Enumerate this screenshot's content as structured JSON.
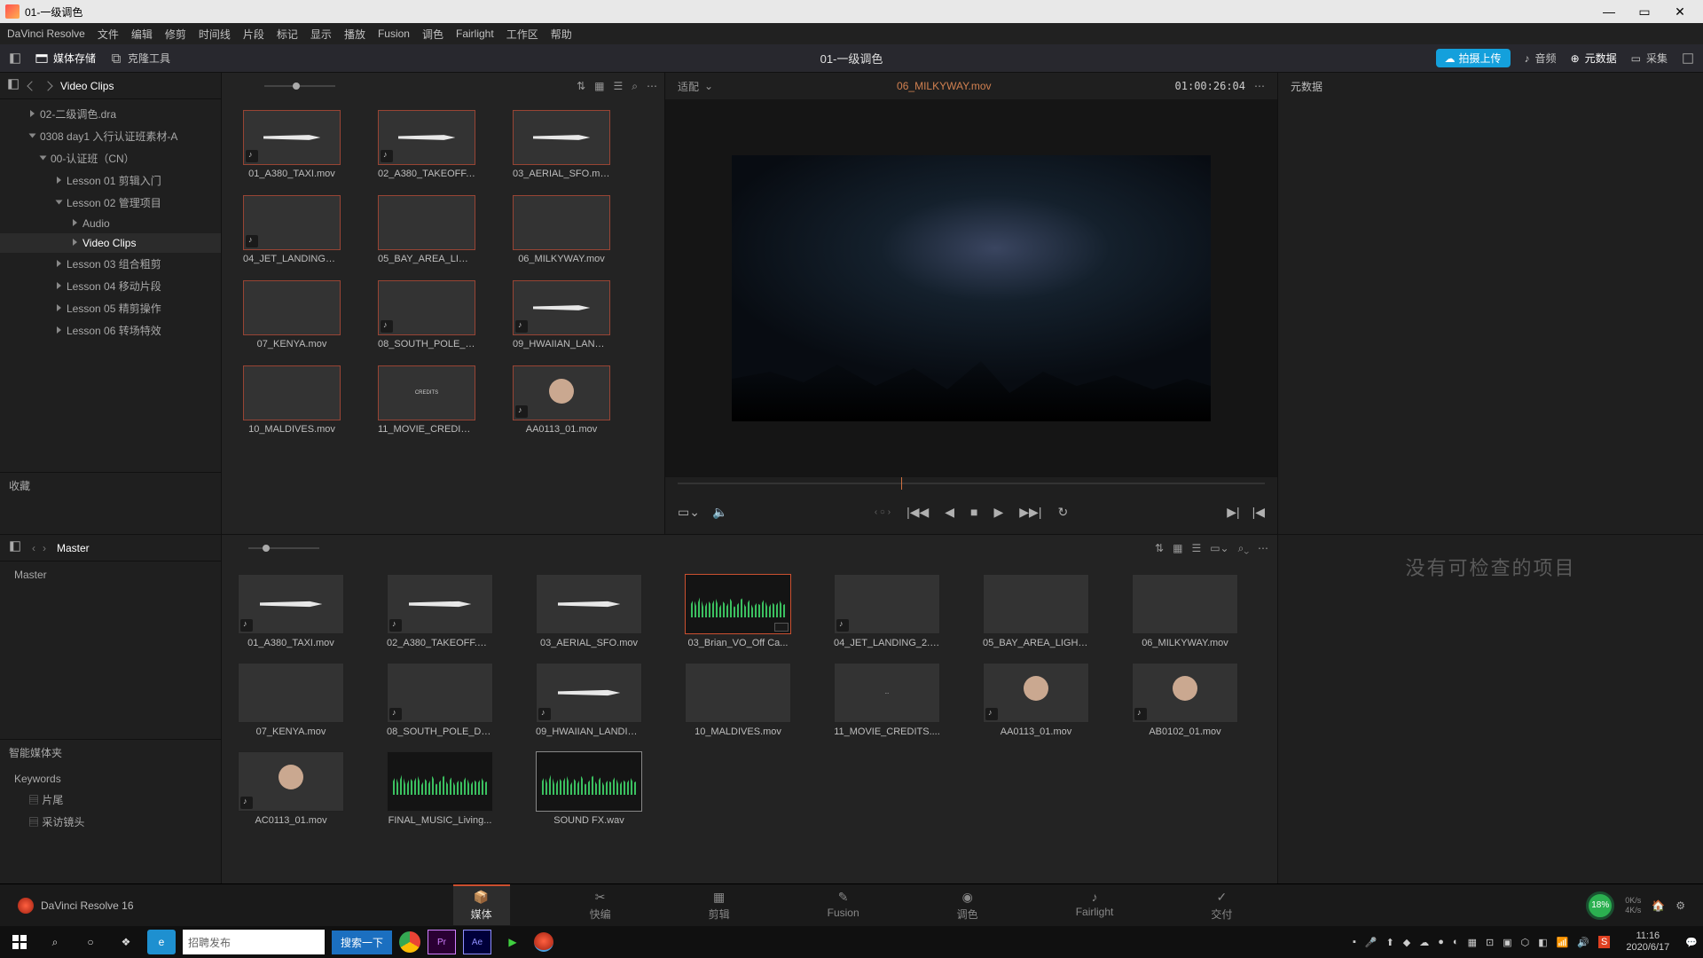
{
  "window": {
    "title": "01-一级调色"
  },
  "menu": [
    "DaVinci Resolve",
    "文件",
    "编辑",
    "修剪",
    "时间线",
    "片段",
    "标记",
    "显示",
    "播放",
    "Fusion",
    "调色",
    "Fairlight",
    "工作区",
    "帮助"
  ],
  "toolbar": {
    "media_pool": "媒体存储",
    "clone_tool": "克隆工具",
    "center_title": "01-一级调色",
    "upload_btn": "拍摄上传",
    "audio": "音频",
    "metadata": "元数据",
    "capture": "采集"
  },
  "tree": {
    "header_label": "Video Clips",
    "items": [
      {
        "lvl": 0,
        "open": false,
        "label": "02-二级调色.dra"
      },
      {
        "lvl": 0,
        "open": true,
        "label": "0308 day1 入行认证班素材-A"
      },
      {
        "lvl": 1,
        "open": true,
        "label": "00-认证班（CN）"
      },
      {
        "lvl": 2,
        "open": false,
        "label": "Lesson 01 剪辑入门"
      },
      {
        "lvl": 2,
        "open": true,
        "label": "Lesson 02 管理项目"
      },
      {
        "lvl": 3,
        "open": false,
        "label": "Audio"
      },
      {
        "lvl": 3,
        "open": false,
        "label": "Video Clips",
        "sel": true
      },
      {
        "lvl": 2,
        "open": false,
        "label": "Lesson 03 组合粗剪"
      },
      {
        "lvl": 2,
        "open": false,
        "label": "Lesson 04 移动片段"
      },
      {
        "lvl": 2,
        "open": false,
        "label": "Lesson 05 精剪操作"
      },
      {
        "lvl": 2,
        "open": false,
        "label": "Lesson 06 转场特效"
      }
    ],
    "favorites": "收藏"
  },
  "source_clips": [
    {
      "name": "01_A380_TAXI.mov",
      "bg": "bg-plane",
      "aud": true,
      "ob": true
    },
    {
      "name": "02_A380_TAKEOFF.m...",
      "bg": "bg-plane",
      "aud": true,
      "ob": true
    },
    {
      "name": "03_AERIAL_SFO.mov",
      "bg": "bg-plane",
      "ob": true
    },
    {
      "name": "04_JET_LANDING_2.m...",
      "bg": "bg-runway",
      "aud": true,
      "ob": true
    },
    {
      "name": "05_BAY_AREA_LIGHT...",
      "bg": "bg-night",
      "ob": true
    },
    {
      "name": "06_MILKYWAY.mov",
      "bg": "bg-dark",
      "ob": true
    },
    {
      "name": "07_KENYA.mov",
      "bg": "bg-sky",
      "ob": true
    },
    {
      "name": "08_SOUTH_POLE_DC...",
      "bg": "bg-snow",
      "aud": true,
      "ob": true
    },
    {
      "name": "09_HWAIIAN_LANDIN...",
      "bg": "bg-plane",
      "aud": true,
      "ob": true
    },
    {
      "name": "10_MALDIVES.mov",
      "bg": "bg-green",
      "ob": true
    },
    {
      "name": "11_MOVIE_CREDITS....",
      "bg": "bg-black",
      "ob": true,
      "text": "CREDITS"
    },
    {
      "name": "AA0113_01.mov",
      "bg": "bg-man",
      "aud": true,
      "ob": true
    }
  ],
  "viewer": {
    "fit_label": "适配",
    "clip_name": "06_MILKYWAY.mov",
    "timecode": "01:00:26:04",
    "meta_tab": "元数据",
    "inspector_msg": "没有可检查的项目"
  },
  "bin": {
    "header": "Master",
    "root": "Master",
    "smart": "智能媒体夹",
    "keywords": "Keywords",
    "kw_items": [
      "片尾",
      "采访镜头"
    ]
  },
  "master_clips": [
    {
      "name": "01_A380_TAXI.mov",
      "bg": "bg-plane",
      "aud": true
    },
    {
      "name": "02_A380_TAKEOFF.m...",
      "bg": "bg-plane",
      "aud": true
    },
    {
      "name": "03_AERIAL_SFO.mov",
      "bg": "bg-plane"
    },
    {
      "name": "03_Brian_VO_Off Ca...",
      "bg": "wave",
      "sel": true,
      "badge": true
    },
    {
      "name": "04_JET_LANDING_2.m...",
      "bg": "bg-runway",
      "aud": true
    },
    {
      "name": "05_BAY_AREA_LIGHT...",
      "bg": "bg-night"
    },
    {
      "name": "06_MILKYWAY.mov",
      "bg": "bg-dark"
    },
    {
      "name": "07_KENYA.mov",
      "bg": "bg-sky"
    },
    {
      "name": "08_SOUTH_POLE_DC...",
      "bg": "bg-snow",
      "aud": true
    },
    {
      "name": "09_HWAIIAN_LANDIN...",
      "bg": "bg-plane",
      "aud": true
    },
    {
      "name": "10_MALDIVES.mov",
      "bg": "bg-green"
    },
    {
      "name": "11_MOVIE_CREDITS....",
      "bg": "bg-black",
      "text": "..."
    },
    {
      "name": "AA0113_01.mov",
      "bg": "bg-man",
      "aud": true
    },
    {
      "name": "AB0102_01.mov",
      "bg": "bg-man",
      "aud": true
    },
    {
      "name": "AC0113_01.mov",
      "bg": "bg-man",
      "aud": true
    },
    {
      "name": "FINAL_MUSIC_Living...",
      "bg": "wave"
    },
    {
      "name": "SOUND FX.wav",
      "bg": "wave",
      "sel2": true
    }
  ],
  "pages": [
    {
      "icon": "📦",
      "label": "媒体",
      "active": true
    },
    {
      "icon": "✂",
      "label": "快编"
    },
    {
      "icon": "▦",
      "label": "剪辑"
    },
    {
      "icon": "✎",
      "label": "Fusion"
    },
    {
      "icon": "◉",
      "label": "调色"
    },
    {
      "icon": "♪",
      "label": "Fairlight"
    },
    {
      "icon": "✓",
      "label": "交付"
    }
  ],
  "footer": {
    "app": "DaVinci Resolve 16",
    "pct": "18%",
    "net1": "0K/s",
    "net2": "4K/s"
  },
  "taskbar": {
    "search_placeholder": "招聘发布",
    "search_btn": "搜索一下",
    "time": "11:16",
    "date": "2020/6/17"
  }
}
